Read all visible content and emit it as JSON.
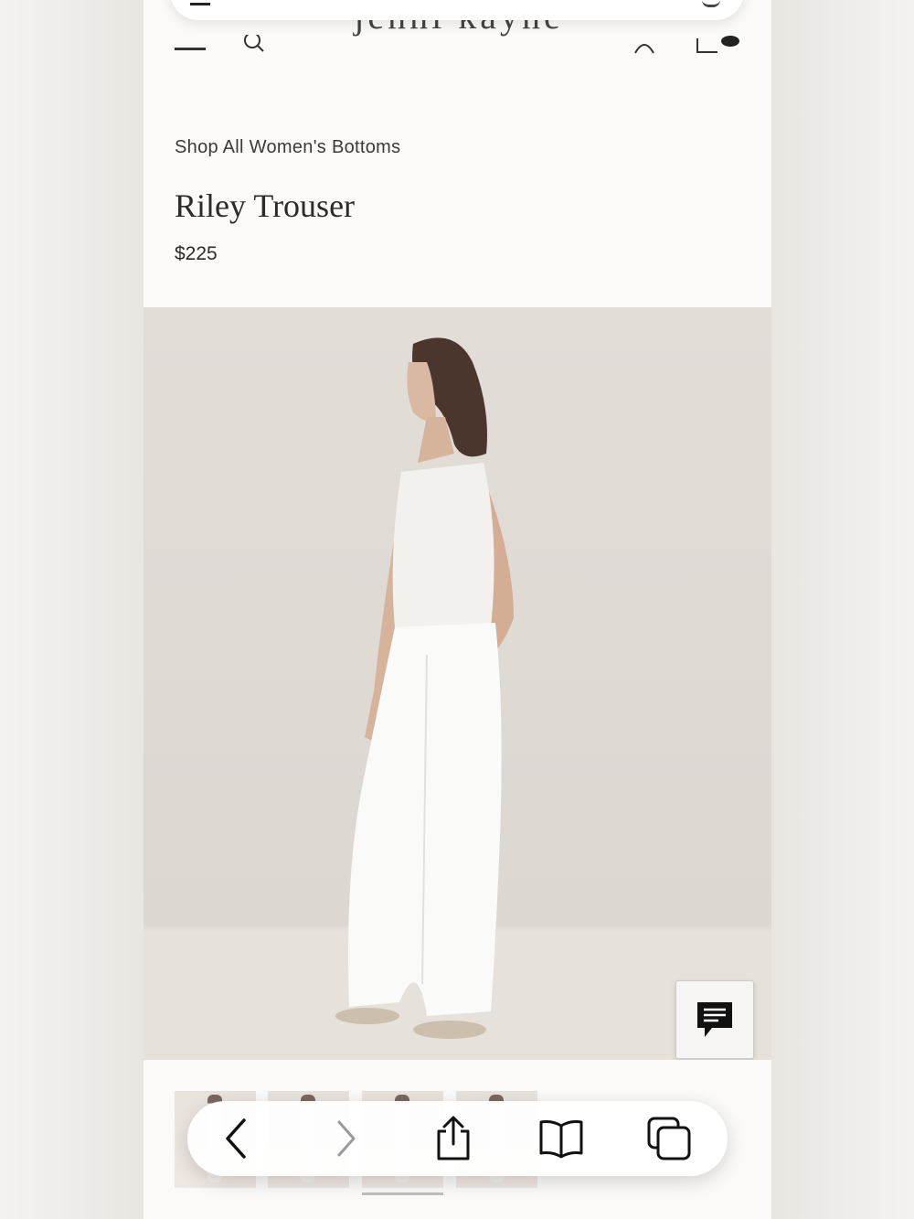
{
  "site": {
    "logo_text": "jenni kayne"
  },
  "product": {
    "breadcrumb": "Shop All Women's Bottoms",
    "title": "Riley Trouser",
    "price": "$225"
  },
  "header_icons": [
    "menu-icon",
    "search-icon",
    "account-icon",
    "cart-icon"
  ],
  "gallery": {
    "thumbnail_count": 4,
    "active_thumbnail": 3
  },
  "browser_toolbar": {
    "buttons": [
      "back-icon",
      "forward-icon",
      "share-icon",
      "bookmarks-icon",
      "tabs-icon"
    ]
  },
  "colors": {
    "page_bg": "#fbfaf8",
    "text": "#2b2b2b",
    "image_bg": "#e3ddd8"
  }
}
